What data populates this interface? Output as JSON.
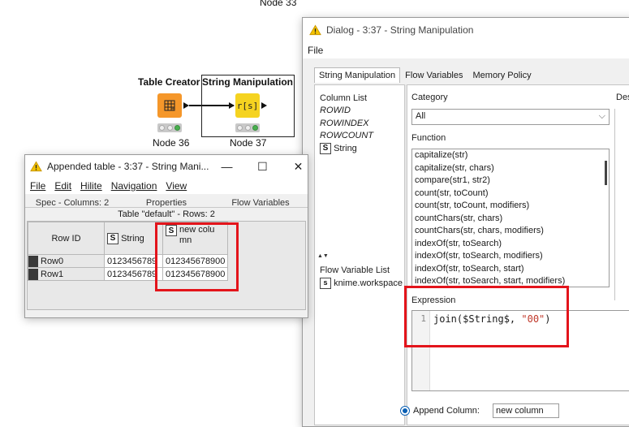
{
  "canvas": {
    "node_top_label": "Node 33",
    "node36": {
      "title": "Table Creator",
      "label": "Node 36"
    },
    "node37": {
      "title": "String Manipulation",
      "label": "Node 37",
      "icon_text": "r[s]"
    }
  },
  "appended_window": {
    "title": "Appended table - 3:37 - String Mani...",
    "menu": [
      "File",
      "Edit",
      "Hilite",
      "Navigation",
      "View"
    ],
    "tabs": [
      "Spec - Columns: 2",
      "Properties",
      "Flow Variables"
    ],
    "table_caption": "Table \"default\" - Rows: 2",
    "columns": [
      "Row ID",
      "String",
      "new colu\nmn"
    ],
    "rows": [
      [
        "Row0",
        "0123456789",
        "012345678900"
      ],
      [
        "Row1",
        "0123456789",
        "012345678900"
      ]
    ]
  },
  "dialog": {
    "title": "Dialog - 3:37 - String Manipulation",
    "menu": [
      "File"
    ],
    "tabs": [
      "String Manipulation",
      "Flow Variables",
      "Memory Policy"
    ],
    "column_list_label": "Column List",
    "column_list": [
      "ROWID",
      "ROWINDEX",
      "ROWCOUNT",
      "String"
    ],
    "flow_variable_label": "Flow Variable List",
    "flow_variables": [
      "knime.workspace"
    ],
    "category_label": "Category",
    "category_value": "All",
    "function_label": "Function",
    "functions": [
      "capitalize(str)",
      "capitalize(str, chars)",
      "compare(str1, str2)",
      "count(str, toCount)",
      "count(str, toCount, modifiers)",
      "countChars(str, chars)",
      "countChars(str, chars, modifiers)",
      "indexOf(str, toSearch)",
      "indexOf(str, toSearch, modifiers)",
      "indexOf(str, toSearch, start)",
      "indexOf(str, toSearch, start, modifiers)"
    ],
    "description_label": "Des",
    "expression_label": "Expression",
    "expression_line_no": "1",
    "expression": {
      "fn": "join(",
      "col": "$String$",
      "sep": ", ",
      "str": "\"00\"",
      "close": ")"
    },
    "append_label": "Append Column:",
    "append_value": "new column"
  },
  "colors": {
    "highlight_red": "#e3141b",
    "node_orange": "#f5972a",
    "node_yellow": "#f5d320",
    "string_literal": "#c0392b"
  }
}
